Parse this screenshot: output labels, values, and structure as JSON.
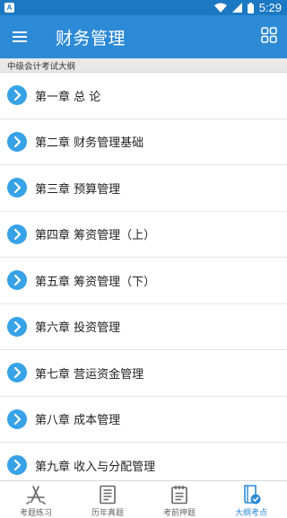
{
  "status_bar": {
    "notification_badge": "A",
    "time": "5:29"
  },
  "app_bar": {
    "title": "财务管理"
  },
  "section": {
    "title": "中级会计考试大纲"
  },
  "chapters": [
    {
      "label": "第一章 总 论"
    },
    {
      "label": "第二章 财务管理基础"
    },
    {
      "label": "第三章 预算管理"
    },
    {
      "label": "第四章 筹资管理（上）"
    },
    {
      "label": "第五章 筹资管理（下）"
    },
    {
      "label": "第六章 投资管理"
    },
    {
      "label": "第七章 营运资金管理"
    },
    {
      "label": "第八章 成本管理"
    },
    {
      "label": "第九章 收入与分配管理"
    }
  ],
  "bottom_nav": {
    "items": [
      {
        "label": "考题练习",
        "icon": "app-store-icon",
        "active": false
      },
      {
        "label": "历年真题",
        "icon": "document-icon",
        "active": false
      },
      {
        "label": "考前押题",
        "icon": "clipboard-icon",
        "active": false
      },
      {
        "label": "大纲考点",
        "icon": "book-check-icon",
        "active": true
      }
    ]
  },
  "colors": {
    "status_bar": "#1b78c2",
    "app_bar": "#2d8ad6",
    "chapter_icon": "#37a2e6",
    "active_nav": "#2d8ad6",
    "section_bg": "#e8e8e8"
  }
}
